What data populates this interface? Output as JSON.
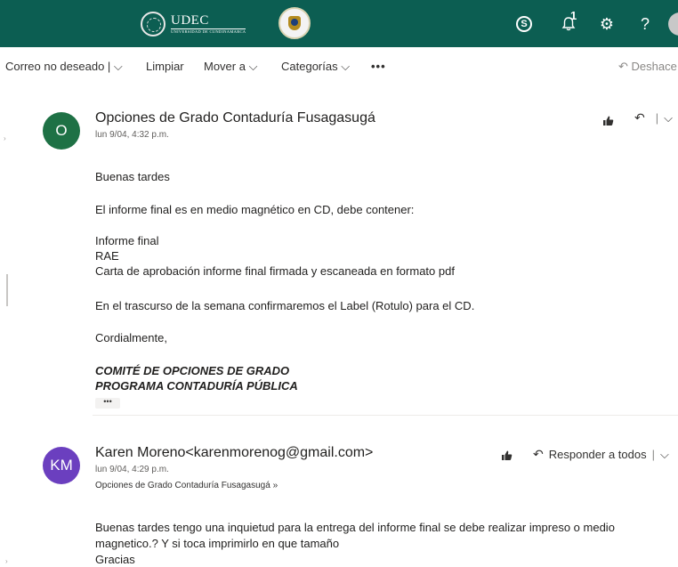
{
  "header": {
    "logo_text": "UDEC",
    "logo_subtitle": "UNIVERSIDAD DE CUNDINAMARCA",
    "bell_badge": "1",
    "icons": [
      "skype-icon",
      "bell-icon",
      "gear-icon",
      "help-icon"
    ],
    "background_color": "#0c5e52"
  },
  "toolbar": {
    "junk": "Correo no deseado |",
    "clean": "Limpiar",
    "move": "Mover a",
    "categories": "Categorías",
    "more": "•••",
    "undo": "Deshace"
  },
  "messages": [
    {
      "avatar_initials": "O",
      "avatar_color": "#1e7145",
      "sender": "Opciones de Grado Contaduría Fusagasugá",
      "date": "lun 9/04, 4:32 p.m.",
      "body": [
        "Buenas tardes",
        "El informe final es en medio magnético en CD, debe contener:",
        "Informe final",
        "RAE",
        "Carta de aprobación informe final firmada y escaneada en formato pdf",
        "En el trascurso de la semana confirmaremos el Label (Rotulo) para el CD.",
        "Cordialmente,"
      ],
      "signature": [
        "COMITÉ DE OPCIONES DE GRADO",
        "PROGRAMA CONTADURÍA PÚBLICA"
      ],
      "collapsed_label": "•••"
    },
    {
      "avatar_initials": "KM",
      "avatar_color": "#6b3fbf",
      "sender": "Karen Moreno<karenmorenog@gmail.com>",
      "date": "lun 9/04, 4:29 p.m.",
      "to": "Opciones de Grado Contaduría Fusagasugá",
      "reply_all_label": "Responder a todos",
      "body": [
        "Buenas tardes tengo una inquietud para la entrega del informe final se debe realizar impreso o medio",
        "magnetico.?  Y si toca imprimirlo en que tamaño",
        "Gracias"
      ]
    }
  ]
}
